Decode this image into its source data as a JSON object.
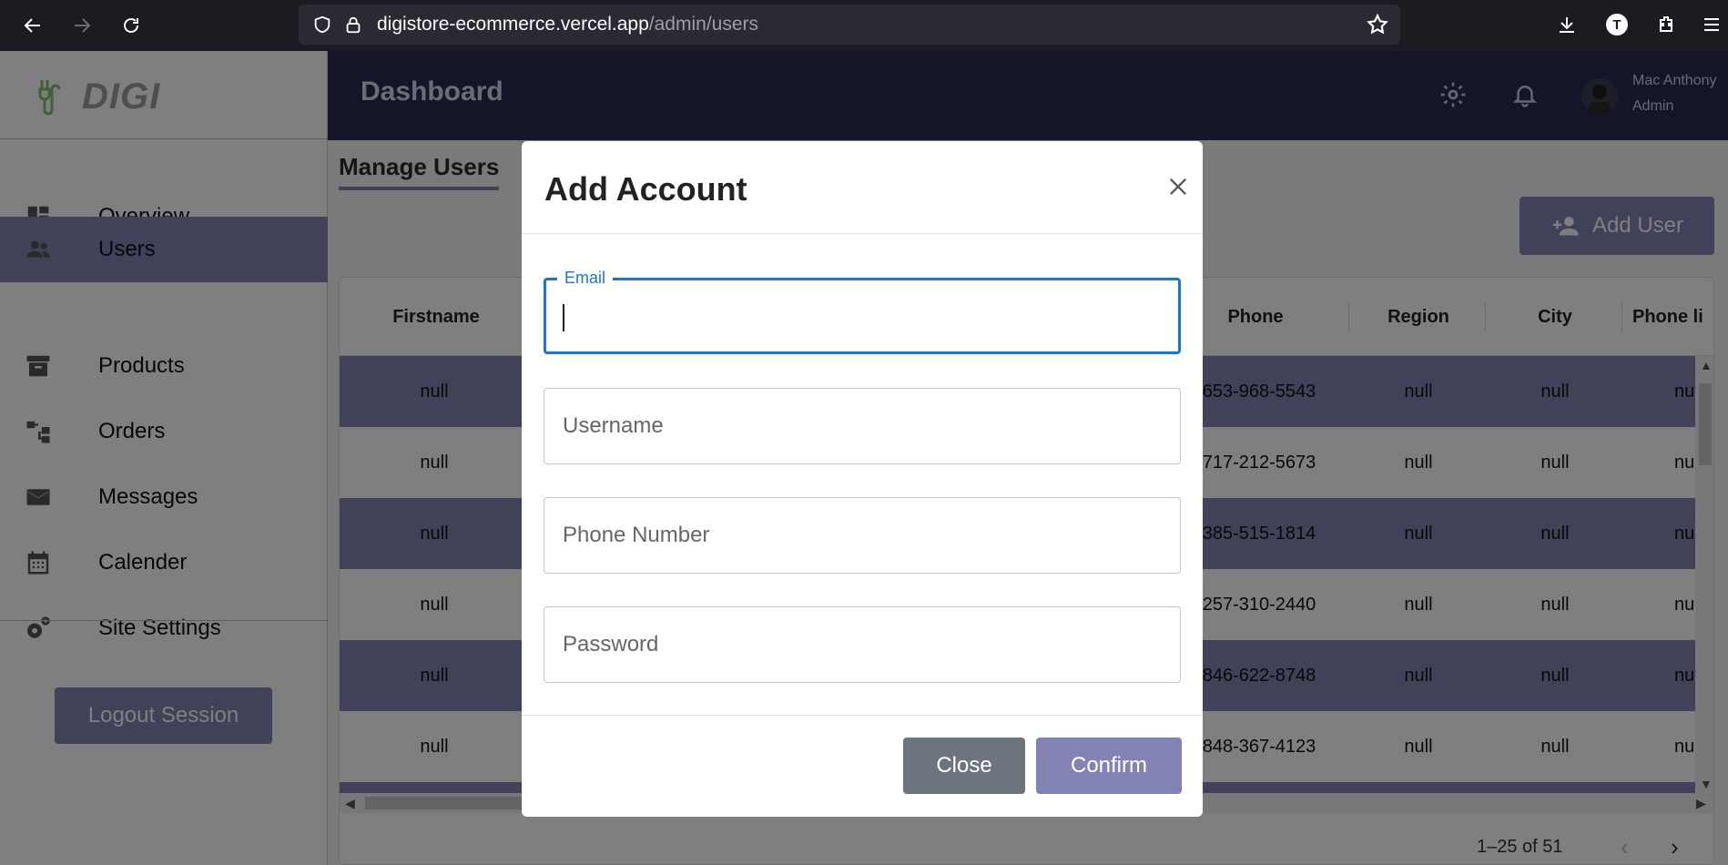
{
  "browser": {
    "url_domain": "digistore-ecommerce.vercel.app",
    "url_path": "/admin/users",
    "profile_initial": "T"
  },
  "sidebar": {
    "logo_text": "DIGI",
    "items": [
      {
        "label": "Overview",
        "icon": "dashboard-icon",
        "active": false
      },
      {
        "label": "Users",
        "icon": "people-icon",
        "active": true
      },
      {
        "label": "Products",
        "icon": "archive-icon",
        "active": false
      },
      {
        "label": "Orders",
        "icon": "account-tree-icon",
        "active": false
      },
      {
        "label": "Messages",
        "icon": "mail-icon",
        "active": false
      },
      {
        "label": "Calender",
        "icon": "calendar-icon",
        "active": false
      },
      {
        "label": "Site Settings",
        "icon": "settings-gears-icon",
        "active": false
      }
    ],
    "logout_label": "Logout Session"
  },
  "header": {
    "title": "Dashboard",
    "user_name": "Mac Anthony",
    "user_role": "Admin"
  },
  "main": {
    "title": "Manage Users",
    "add_user_label": "Add User",
    "table": {
      "columns": [
        "Firstname",
        "Phone",
        "Region",
        "City",
        "Phone li"
      ],
      "rows": [
        {
          "firstname": "null",
          "phone": "653-968-5543",
          "region": "null",
          "city": "null",
          "phone_li": "nu"
        },
        {
          "firstname": "null",
          "phone": "717-212-5673",
          "region": "null",
          "city": "null",
          "phone_li": "nu"
        },
        {
          "firstname": "null",
          "phone": "385-515-1814",
          "region": "null",
          "city": "null",
          "phone_li": "nu"
        },
        {
          "firstname": "null",
          "phone": "257-310-2440",
          "region": "null",
          "city": "null",
          "phone_li": "nu"
        },
        {
          "firstname": "null",
          "phone": "846-622-8748",
          "region": "null",
          "city": "null",
          "phone_li": "nu"
        },
        {
          "firstname": "null",
          "phone": "848-367-4123",
          "region": "null",
          "city": "null",
          "phone_li": "nu"
        }
      ],
      "pagination": "1–25 of 51"
    }
  },
  "modal": {
    "title": "Add Account",
    "fields": {
      "email_label": "Email",
      "email_value": "",
      "username_placeholder": "Username",
      "phone_placeholder": "Phone Number",
      "password_placeholder": "Password"
    },
    "close_label": "Close",
    "confirm_label": "Confirm"
  },
  "colors": {
    "accent": "#8382b5",
    "topbar": "#2b2b52",
    "focus": "#1976d2",
    "secondary_button": "#6c757d"
  }
}
